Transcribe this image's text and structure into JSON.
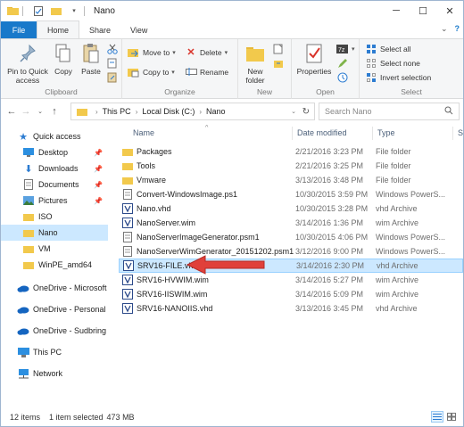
{
  "window": {
    "title": "Nano",
    "controls": {
      "minimize": "─",
      "maximize": "☐",
      "close": "✕"
    }
  },
  "ribbon_tabs": {
    "file": "File",
    "home": "Home",
    "share": "Share",
    "view": "View"
  },
  "ribbon": {
    "clipboard": {
      "label": "Clipboard",
      "pin": "Pin to Quick access",
      "copy": "Copy",
      "paste": "Paste"
    },
    "organize": {
      "label": "Organize",
      "move_to": "Move to",
      "copy_to": "Copy to",
      "delete": "Delete",
      "rename": "Rename"
    },
    "new": {
      "label": "New",
      "new_folder": "New folder"
    },
    "open": {
      "label": "Open",
      "properties": "Properties"
    },
    "select": {
      "label": "Select",
      "select_all": "Select all",
      "select_none": "Select none",
      "invert": "Invert selection"
    }
  },
  "address": {
    "crumbs": [
      "This PC",
      "Local Disk (C:)",
      "Nano"
    ],
    "search_placeholder": "Search Nano"
  },
  "nav": {
    "items": [
      {
        "label": "Quick access",
        "icon": "star-icon",
        "pinned": false
      },
      {
        "label": "Desktop",
        "icon": "desktop-icon",
        "pinned": true
      },
      {
        "label": "Downloads",
        "icon": "download-icon",
        "pinned": true
      },
      {
        "label": "Documents",
        "icon": "documents-icon",
        "pinned": true
      },
      {
        "label": "Pictures",
        "icon": "pictures-icon",
        "pinned": true
      },
      {
        "label": "ISO",
        "icon": "folder-icon",
        "pinned": false
      },
      {
        "label": "Nano",
        "icon": "folder-icon",
        "pinned": false
      },
      {
        "label": "VM",
        "icon": "folder-icon",
        "pinned": false
      },
      {
        "label": "WinPE_amd64",
        "icon": "folder-icon",
        "pinned": false
      },
      {
        "label": "OneDrive - Microsoft",
        "icon": "onedrive-icon",
        "pinned": false
      },
      {
        "label": "OneDrive - Personal",
        "icon": "onedrive-icon",
        "pinned": false
      },
      {
        "label": "OneDrive - Sudbring",
        "icon": "onedrive-icon",
        "pinned": false
      },
      {
        "label": "This PC",
        "icon": "computer-icon",
        "pinned": false
      },
      {
        "label": "Network",
        "icon": "network-icon",
        "pinned": false
      }
    ]
  },
  "files": {
    "headers": {
      "name": "Name",
      "date": "Date modified",
      "type": "Type",
      "size": "Si"
    },
    "rows": [
      {
        "name": "Packages",
        "date": "2/21/2016 3:23 PM",
        "type": "File folder",
        "icon": "folder-icon"
      },
      {
        "name": "Tools",
        "date": "2/21/2016 3:25 PM",
        "type": "File folder",
        "icon": "folder-icon"
      },
      {
        "name": "Vmware",
        "date": "3/13/2016 3:48 PM",
        "type": "File folder",
        "icon": "folder-icon"
      },
      {
        "name": "Convert-WindowsImage.ps1",
        "date": "10/30/2015 3:59 PM",
        "type": "Windows PowerS...",
        "icon": "script-icon"
      },
      {
        "name": "Nano.vhd",
        "date": "10/30/2015 3:28 PM",
        "type": "vhd Archive",
        "icon": "archive-icon"
      },
      {
        "name": "NanoServer.wim",
        "date": "3/14/2016 1:36 PM",
        "type": "wim Archive",
        "icon": "archive-icon"
      },
      {
        "name": "NanoServerImageGenerator.psm1",
        "date": "10/30/2015 4:06 PM",
        "type": "Windows PowerS...",
        "icon": "script-icon"
      },
      {
        "name": "NanoServerWimGenerator_20151202.psm1",
        "date": "3/12/2016 9:00 PM",
        "type": "Windows PowerS...",
        "icon": "script-icon"
      },
      {
        "name": "SRV16-FILE.vhd",
        "date": "3/14/2016 2:30 PM",
        "type": "vhd Archive",
        "icon": "archive-icon"
      },
      {
        "name": "SRV16-HVWIM.wim",
        "date": "3/14/2016 5:27 PM",
        "type": "wim Archive",
        "icon": "archive-icon"
      },
      {
        "name": "SRV16-IISWIM.wim",
        "date": "3/14/2016 5:09 PM",
        "type": "wim Archive",
        "icon": "archive-icon"
      },
      {
        "name": "SRV16-NANOIIS.vhd",
        "date": "3/13/2016 3:45 PM",
        "type": "vhd Archive",
        "icon": "archive-icon"
      }
    ]
  },
  "status": {
    "count": "12 items",
    "selected": "1 item selected",
    "size": "473 MB"
  },
  "colors": {
    "accent": "#1979ca",
    "selection": "#cce8ff",
    "arrow": "#e0403a",
    "folder": "#f2c94c"
  }
}
